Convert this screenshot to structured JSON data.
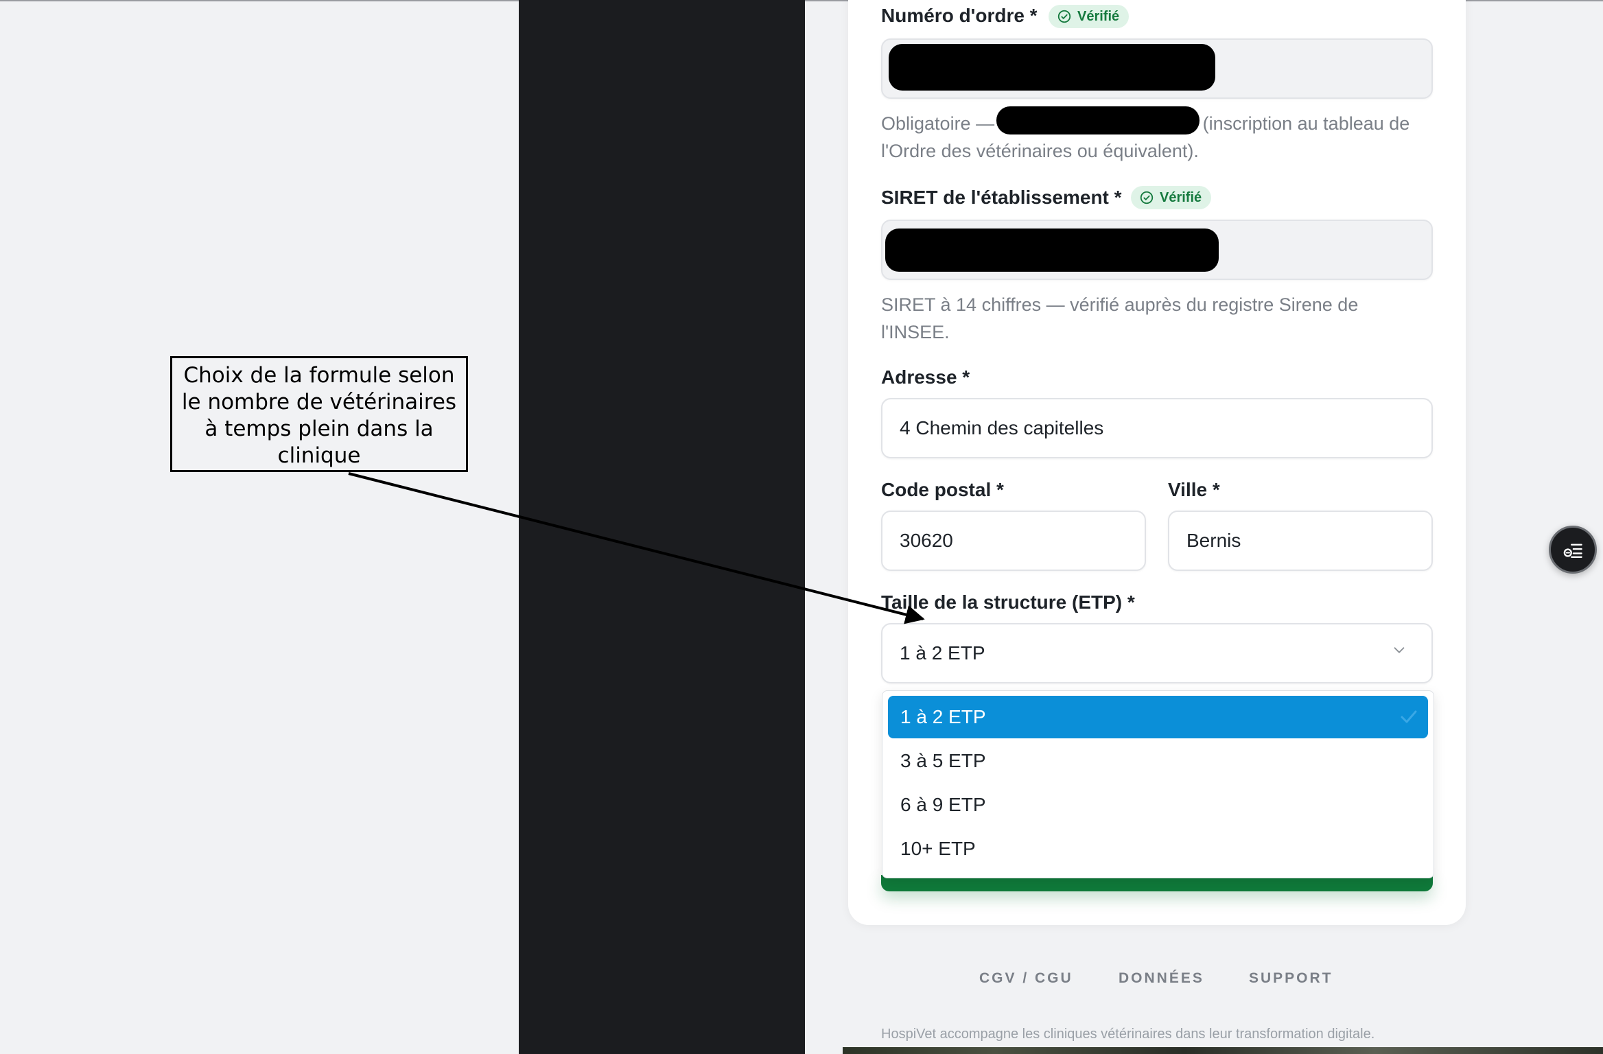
{
  "colors": {
    "dark_panel": "#1b1c1f",
    "selected_option": "#0b8fd8",
    "submit_green": "#0f7a3a",
    "verified_badge_bg": "#dff3e7",
    "verified_badge_text": "#157a3e"
  },
  "form": {
    "order_number": {
      "label": "Numéro d'ordre *",
      "badge": "Vérifié",
      "help_prefix": "Obligatoire —",
      "help_suffix": "(inscription au tableau de l'Ordre des vétérinaires ou équivalent)."
    },
    "siret": {
      "label": "SIRET de l'établissement *",
      "badge": "Vérifié",
      "help": "SIRET à 14 chiffres — vérifié auprès du registre Sirene de l'INSEE."
    },
    "address": {
      "label": "Adresse *",
      "value": "4 Chemin des capitelles"
    },
    "postal_code": {
      "label": "Code postal *",
      "value": "30620"
    },
    "city": {
      "label": "Ville *",
      "value": "Bernis"
    },
    "structure_size": {
      "label": "Taille de la structure (ETP) *",
      "value": "1 à 2 ETP",
      "options": [
        "1 à 2 ETP",
        "3 à 5 ETP",
        "6 à 9 ETP",
        "10+ ETP"
      ],
      "selected_index": 0
    }
  },
  "footer": {
    "links": [
      "CGV / CGU",
      "DONNÉES",
      "SUPPORT"
    ],
    "tagline": "HospiVet accompagne les cliniques vétérinaires dans leur transformation digitale."
  },
  "annotation": {
    "text": "Choix de la formule selon le nombre de vétérinaires à temps plein dans la clinique"
  },
  "icons": {
    "verified": "check-circle-icon",
    "dropdown": "chevron-down-icon",
    "selected": "checkmark-icon",
    "floating": "list-menu-icon"
  }
}
